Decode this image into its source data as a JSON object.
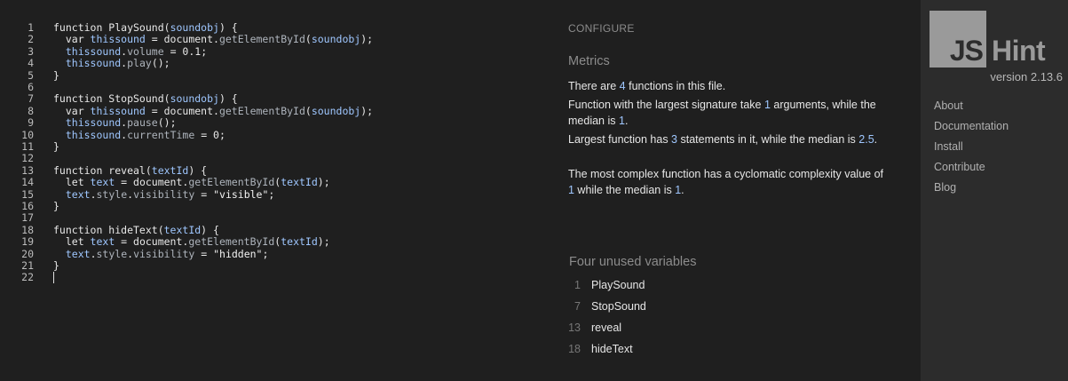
{
  "editor": {
    "lines": [
      {
        "n": "1",
        "tokens": [
          [
            "function PlaySound(",
            ""
          ],
          [
            "soundobj",
            "v"
          ],
          [
            ") {",
            ""
          ]
        ]
      },
      {
        "n": "2",
        "tokens": [
          [
            "  var ",
            ""
          ],
          [
            "thissound",
            "v"
          ],
          [
            " = document.",
            ""
          ],
          [
            "getElementById",
            "p"
          ],
          [
            "(",
            ""
          ],
          [
            "soundobj",
            "v"
          ],
          [
            ");",
            ""
          ]
        ]
      },
      {
        "n": "3",
        "tokens": [
          [
            "  ",
            ""
          ],
          [
            "thissound",
            "v"
          ],
          [
            ".",
            ""
          ],
          [
            "volume",
            "p"
          ],
          [
            " = 0.1;",
            ""
          ]
        ]
      },
      {
        "n": "4",
        "tokens": [
          [
            "  ",
            ""
          ],
          [
            "thissound",
            "v"
          ],
          [
            ".",
            ""
          ],
          [
            "play",
            "p"
          ],
          [
            "();",
            ""
          ]
        ]
      },
      {
        "n": "5",
        "tokens": [
          [
            "}",
            ""
          ]
        ]
      },
      {
        "n": "6",
        "tokens": []
      },
      {
        "n": "7",
        "tokens": [
          [
            "function StopSound(",
            ""
          ],
          [
            "soundobj",
            "v"
          ],
          [
            ") {",
            ""
          ]
        ]
      },
      {
        "n": "8",
        "tokens": [
          [
            "  var ",
            ""
          ],
          [
            "thissound",
            "v"
          ],
          [
            " = document.",
            ""
          ],
          [
            "getElementById",
            "p"
          ],
          [
            "(",
            ""
          ],
          [
            "soundobj",
            "v"
          ],
          [
            ");",
            ""
          ]
        ]
      },
      {
        "n": "9",
        "tokens": [
          [
            "  ",
            ""
          ],
          [
            "thissound",
            "v"
          ],
          [
            ".",
            ""
          ],
          [
            "pause",
            "p"
          ],
          [
            "();",
            ""
          ]
        ]
      },
      {
        "n": "10",
        "tokens": [
          [
            "  ",
            ""
          ],
          [
            "thissound",
            "v"
          ],
          [
            ".",
            ""
          ],
          [
            "currentTime",
            "p"
          ],
          [
            " = 0;",
            ""
          ]
        ]
      },
      {
        "n": "11",
        "tokens": [
          [
            "}",
            ""
          ]
        ]
      },
      {
        "n": "12",
        "tokens": []
      },
      {
        "n": "13",
        "tokens": [
          [
            "function reveal(",
            ""
          ],
          [
            "textId",
            "v"
          ],
          [
            ") {",
            ""
          ]
        ]
      },
      {
        "n": "14",
        "tokens": [
          [
            "  let ",
            ""
          ],
          [
            "text",
            "v"
          ],
          [
            " = document.",
            ""
          ],
          [
            "getElementById",
            "p"
          ],
          [
            "(",
            ""
          ],
          [
            "textId",
            "v"
          ],
          [
            ");",
            ""
          ]
        ]
      },
      {
        "n": "15",
        "tokens": [
          [
            "  ",
            ""
          ],
          [
            "text",
            "v"
          ],
          [
            ".",
            ""
          ],
          [
            "style",
            "p"
          ],
          [
            ".",
            ""
          ],
          [
            "visibility",
            "p"
          ],
          [
            " = ",
            ""
          ],
          [
            "\"visible\"",
            "s"
          ],
          [
            ";",
            ""
          ]
        ]
      },
      {
        "n": "16",
        "tokens": [
          [
            "}",
            ""
          ]
        ]
      },
      {
        "n": "17",
        "tokens": []
      },
      {
        "n": "18",
        "tokens": [
          [
            "function hideText(",
            ""
          ],
          [
            "textId",
            "v"
          ],
          [
            ") {",
            ""
          ]
        ]
      },
      {
        "n": "19",
        "tokens": [
          [
            "  let ",
            ""
          ],
          [
            "text",
            "v"
          ],
          [
            " = document.",
            ""
          ],
          [
            "getElementById",
            "p"
          ],
          [
            "(",
            ""
          ],
          [
            "textId",
            "v"
          ],
          [
            ");",
            ""
          ]
        ]
      },
      {
        "n": "20",
        "tokens": [
          [
            "  ",
            ""
          ],
          [
            "text",
            "v"
          ],
          [
            ".",
            ""
          ],
          [
            "style",
            "p"
          ],
          [
            ".",
            ""
          ],
          [
            "visibility",
            "p"
          ],
          [
            " = ",
            ""
          ],
          [
            "\"hidden\"",
            "s"
          ],
          [
            ";",
            ""
          ]
        ]
      },
      {
        "n": "21",
        "tokens": [
          [
            "}",
            ""
          ]
        ]
      },
      {
        "n": "22",
        "tokens": []
      }
    ]
  },
  "report": {
    "configure_label": "CONFIGURE",
    "metrics_heading": "Metrics",
    "metric_1": {
      "a": "There are ",
      "n1": "4",
      "b": " functions in this file."
    },
    "metric_2": {
      "a": "Function with the largest signature take ",
      "n1": "1",
      "b": " arguments, while the median is ",
      "n2": "1",
      "c": "."
    },
    "metric_3": {
      "a": "Largest function has ",
      "n1": "3",
      "b": " statements in it, while the median is ",
      "n2": "2.5",
      "c": "."
    },
    "metric_4": {
      "a": "The most complex function has a cyclomatic complexity value of ",
      "n1": "1",
      "b": " while the median is ",
      "n2": "1",
      "c": "."
    },
    "unused_heading": "Four unused variables",
    "unused": [
      {
        "line": "1",
        "name": "PlaySound"
      },
      {
        "line": "7",
        "name": "StopSound"
      },
      {
        "line": "13",
        "name": "reveal"
      },
      {
        "line": "18",
        "name": "hideText"
      }
    ]
  },
  "sidebar": {
    "logo_js": "JS",
    "logo_hint": "Hint",
    "version": "version 2.13.6",
    "nav": [
      "About",
      "Documentation",
      "Install",
      "Contribute",
      "Blog"
    ]
  },
  "colors": {
    "background": "#1f1f1f",
    "sidebar": "#2c2c2c",
    "accent_number": "#9fc7ff",
    "logo": "#9a9a9a"
  }
}
